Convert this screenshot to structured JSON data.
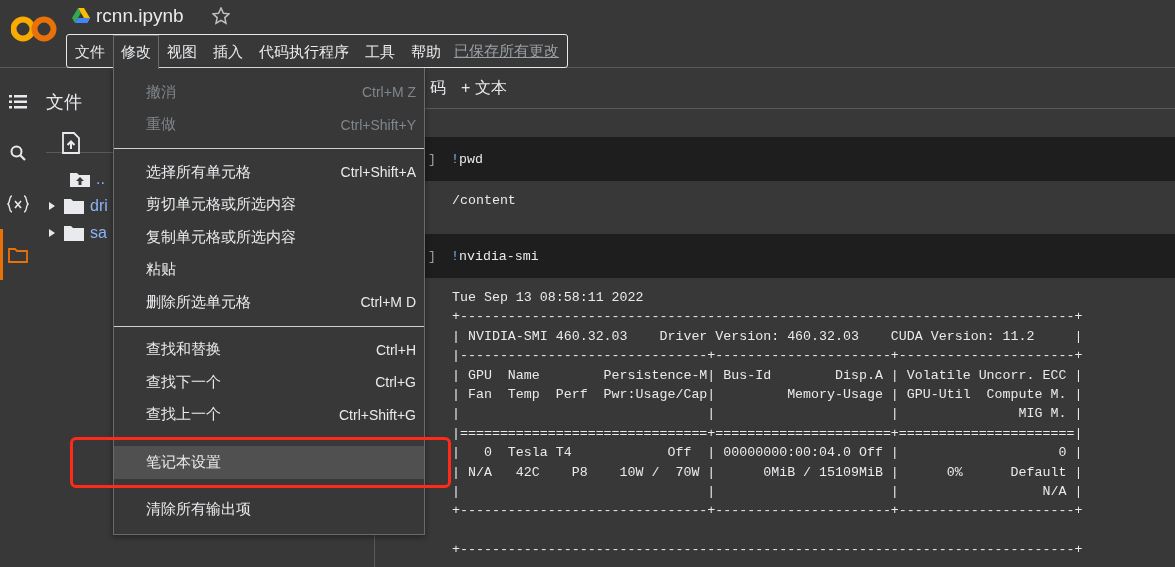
{
  "header": {
    "title": "rcnn.ipynb",
    "starred": false,
    "menu": [
      {
        "label": "文件",
        "selected": false
      },
      {
        "label": "修改",
        "selected": true
      },
      {
        "label": "视图",
        "selected": false
      },
      {
        "label": "插入",
        "selected": false
      },
      {
        "label": "代码执行程序",
        "selected": false
      },
      {
        "label": "工具",
        "selected": false
      },
      {
        "label": "帮助",
        "selected": false
      }
    ],
    "save_status": "已保存所有更改"
  },
  "rail": [
    {
      "kind": "toc",
      "selected": false
    },
    {
      "kind": "search",
      "selected": false
    },
    {
      "kind": "variables",
      "selected": false
    },
    {
      "kind": "files",
      "selected": true
    }
  ],
  "file_panel": {
    "title": "文件",
    "tree": [
      {
        "kind": "parent",
        "label": ".."
      },
      {
        "kind": "folder",
        "label": "dri",
        "expanded": false
      },
      {
        "kind": "folder",
        "label": "sa",
        "expanded": false
      }
    ]
  },
  "toolbar": [
    "码",
    "+ 文本"
  ],
  "cells": [
    {
      "prompt": "]",
      "magic": "!",
      "command": "pwd",
      "output": [
        [
          "/content"
        ]
      ]
    },
    {
      "prompt": "]",
      "magic": "!",
      "command": "nvidia-smi",
      "output": [
        [
          "Tue Sep 13 08:58:11 2022",
          "+-----------------------------------------------------------------------------+",
          "| NVIDIA-SMI 460.32.03    Driver Version: 460.32.03    CUDA Version: 11.2     |",
          "|-------------------------------+----------------------+----------------------+",
          "| GPU  Name        Persistence-M| Bus-Id        Disp.A | Volatile Uncorr. ECC |",
          "| Fan  Temp  Perf  Pwr:Usage/Cap|         Memory-Usage | GPU-Util  Compute M. |",
          "|                               |                      |               MIG M. |",
          "|===============================+======================+======================|",
          "|   0  Tesla T4            Off  | 00000000:00:04.0 Off |                    0 |",
          "| N/A   42C    P8    10W /  70W |      0MiB / 15109MiB |      0%      Default |",
          "|                               |                      |                  N/A |",
          "+-------------------------------+----------------------+----------------------+"
        ],
        [
          "+-----------------------------------------------------------------------------+"
        ]
      ]
    }
  ],
  "edit_menu": [
    {
      "kind": "item",
      "label": "撤消",
      "shortcut": "Ctrl+M Z",
      "disabled": true,
      "selected": false
    },
    {
      "kind": "item",
      "label": "重做",
      "shortcut": "Ctrl+Shift+Y",
      "disabled": true,
      "selected": false
    },
    {
      "kind": "divider"
    },
    {
      "kind": "item",
      "label": "选择所有单元格",
      "shortcut": "Ctrl+Shift+A",
      "disabled": false,
      "selected": false
    },
    {
      "kind": "item",
      "label": "剪切单元格或所选内容",
      "disabled": false,
      "selected": false
    },
    {
      "kind": "item",
      "label": "复制单元格或所选内容",
      "disabled": false,
      "selected": false
    },
    {
      "kind": "item",
      "label": "粘贴",
      "disabled": false,
      "selected": false
    },
    {
      "kind": "item",
      "label": "删除所选单元格",
      "shortcut": "Ctrl+M D",
      "disabled": false,
      "selected": false
    },
    {
      "kind": "divider"
    },
    {
      "kind": "item",
      "label": "查找和替换",
      "shortcut": "Ctrl+H",
      "disabled": false,
      "selected": false
    },
    {
      "kind": "item",
      "label": "查找下一个",
      "shortcut": "Ctrl+G",
      "disabled": false,
      "selected": false
    },
    {
      "kind": "item",
      "label": "查找上一个",
      "shortcut": "Ctrl+Shift+G",
      "disabled": false,
      "selected": false
    },
    {
      "kind": "divider"
    },
    {
      "kind": "item",
      "label": "笔记本设置",
      "disabled": false,
      "selected": true
    },
    {
      "kind": "divider"
    },
    {
      "kind": "item",
      "label": "清除所有输出项",
      "disabled": false,
      "selected": false
    }
  ]
}
